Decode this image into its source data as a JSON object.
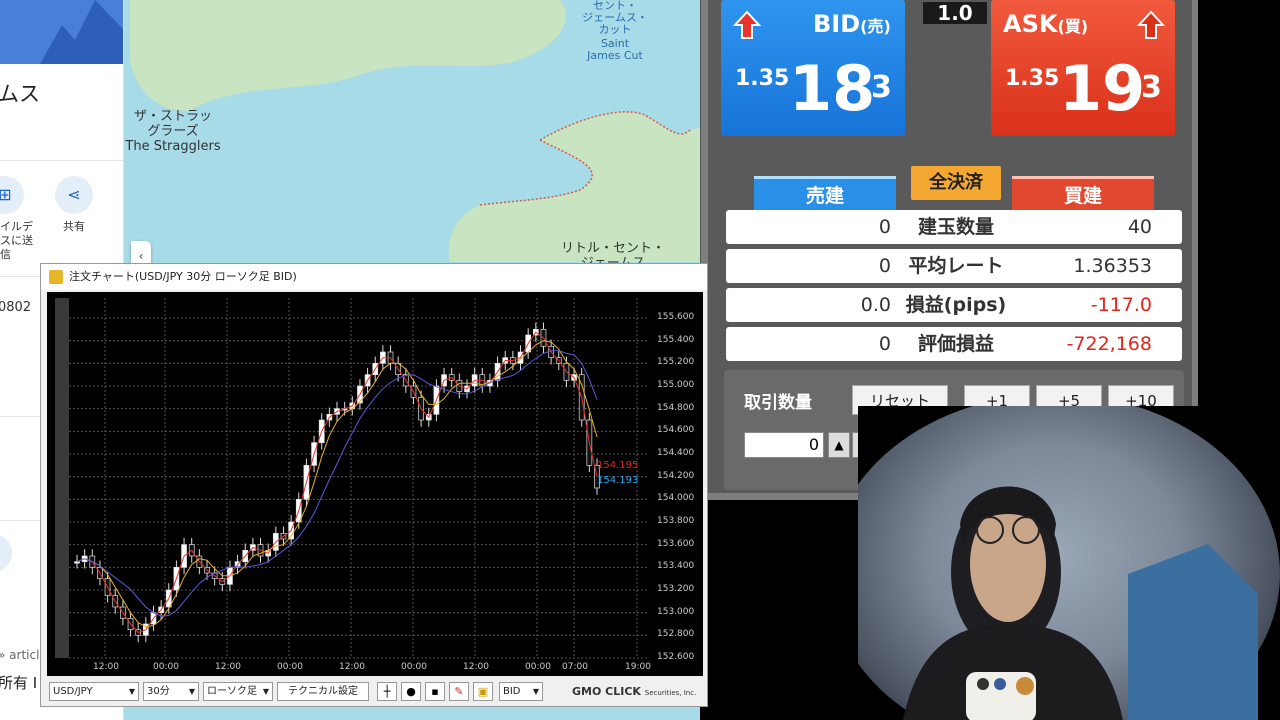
{
  "map": {
    "labels": [
      {
        "text": "セント・\nジェームス・\nカット",
        "id": "saint-james-cut-ja"
      },
      {
        "text": "Saint\nJames Cut",
        "id": "saint-james-cut-en"
      },
      {
        "text": "ザ・ストラッ\nグラーズ\nThe Stragglers",
        "id": "stragglers"
      },
      {
        "text": "リトル・セント・\nジェームス",
        "id": "little-st-james"
      }
    ]
  },
  "side_panel": {
    "title": "ムス",
    "action_mobile": "イルデ\nスに送\n信",
    "action_share": "共有",
    "code": "0802",
    "bottom_link": "» articl",
    "bottom_text": "所有 I"
  },
  "trade_panel": {
    "bid": {
      "label": "BID",
      "label_sub": "(売)",
      "prefix": "1.35",
      "big": "18",
      "sup": "3"
    },
    "ask": {
      "label": "ASK",
      "label_sub": "(買)",
      "prefix": "1.35",
      "big": "19",
      "sup": "3"
    },
    "spread": "1.0",
    "sell_button": "売建",
    "close_all_button": "全決済",
    "buy_button": "買建",
    "rows": [
      {
        "left": "0",
        "label": "建玉数量",
        "right": "40",
        "right_red": false
      },
      {
        "left": "0",
        "label": "平均レート",
        "right": "1.36353",
        "right_red": false
      },
      {
        "left": "0.0",
        "label": "損益(pips)",
        "right": "-117.0",
        "right_red": true
      },
      {
        "left": "0",
        "label": "評価損益",
        "right": "-722,168",
        "right_red": true
      }
    ],
    "qty_label": "取引数量",
    "reset_button": "リセット",
    "plus1": "+1",
    "plus5": "+5",
    "plus10": "+10",
    "qty_value": "0"
  },
  "chart_window": {
    "title": "注文チャート(USD/JPY 30分 ローソク足 BID)",
    "price_ask_label": "154.195",
    "price_bid_label": "154.193",
    "ask_color": "#e8202a",
    "bid_color": "#2aa8e8",
    "toolbar": {
      "pair": "USD/JPY",
      "interval": "30分",
      "chart_type": "ローソク足",
      "technical": "テクニカル設定",
      "side": "BID",
      "brand": "GMO CLICK",
      "brand_sub": "Securities, Inc."
    }
  },
  "chart_data": {
    "type": "candlestick",
    "y_ticks": [
      "155.600",
      "155.400",
      "155.200",
      "155.000",
      "154.800",
      "154.600",
      "154.400",
      "154.200",
      "154.000",
      "153.800",
      "153.600",
      "153.400",
      "153.200",
      "153.000",
      "152.800",
      "152.600"
    ],
    "x_ticks": [
      "12:00",
      "00:00",
      "12:00",
      "00:00",
      "12:00",
      "00:00",
      "12:00",
      "00:00",
      "07:00",
      "19:00"
    ],
    "ylim": [
      152.6,
      155.6
    ],
    "close_series": [
      153.45,
      153.5,
      153.4,
      153.3,
      153.15,
      153.05,
      152.95,
      152.85,
      152.8,
      152.9,
      153.0,
      153.05,
      153.2,
      153.4,
      153.6,
      153.5,
      153.4,
      153.35,
      153.3,
      153.25,
      153.4,
      153.45,
      153.55,
      153.6,
      153.5,
      153.55,
      153.7,
      153.65,
      153.8,
      154.0,
      154.3,
      154.5,
      154.7,
      154.75,
      154.8,
      154.8,
      154.85,
      155.0,
      155.1,
      155.2,
      155.3,
      155.2,
      155.1,
      155.0,
      154.9,
      154.7,
      154.75,
      155.0,
      155.1,
      155.05,
      154.95,
      155.0,
      155.1,
      155.0,
      155.05,
      155.2,
      155.25,
      155.2,
      155.3,
      155.45,
      155.5,
      155.35,
      155.25,
      155.2,
      155.05,
      155.1,
      154.7,
      154.3,
      154.1
    ]
  }
}
